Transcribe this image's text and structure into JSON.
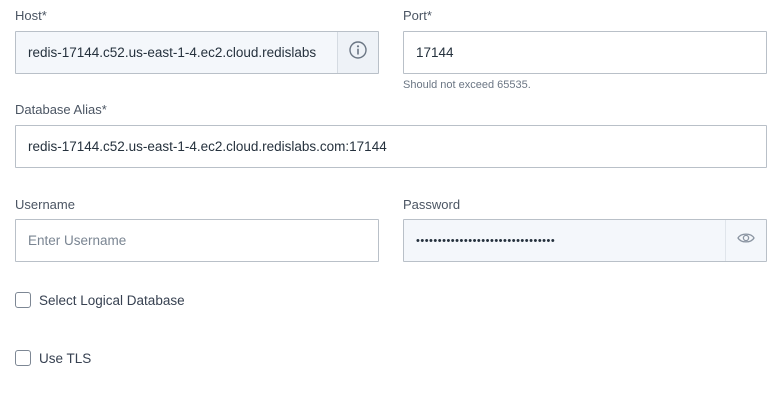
{
  "host": {
    "label": "Host*",
    "value": "redis-17144.c52.us-east-1-4.ec2.cloud.redislabs",
    "info_icon": "info-icon"
  },
  "port": {
    "label": "Port*",
    "value": "17144",
    "help": "Should not exceed 65535."
  },
  "alias": {
    "label": "Database Alias*",
    "value": "redis-17144.c52.us-east-1-4.ec2.cloud.redislabs.com:17144"
  },
  "username": {
    "label": "Username",
    "value": "",
    "placeholder": "Enter Username"
  },
  "password": {
    "label": "Password",
    "value": "••••••••••••••••••••••••••••••••",
    "toggle_icon": "eye-icon"
  },
  "logical_db": {
    "label": "Select Logical Database",
    "checked": false
  },
  "tls": {
    "label": "Use TLS",
    "checked": false
  },
  "colors": {
    "border": "#b9c0c8",
    "tinted_bg": "#f4f7fb",
    "text": "#25313d"
  }
}
